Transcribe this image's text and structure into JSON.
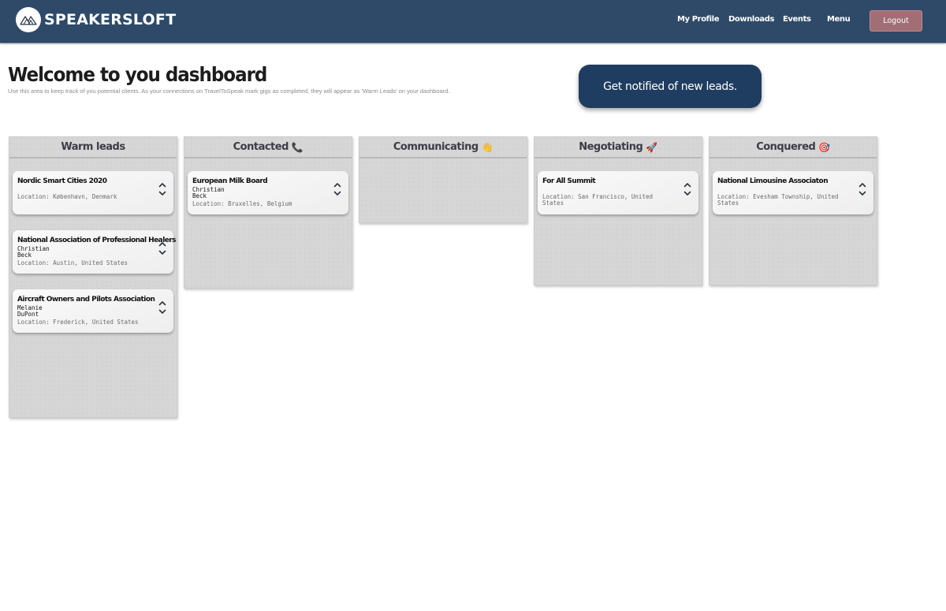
{
  "header": {
    "brand": "SPEAKERSLOFT",
    "logo_icon": "mountain-logo-icon",
    "nav": [
      {
        "label": "My Profile"
      },
      {
        "label": "Downloads"
      },
      {
        "label": "Events"
      },
      {
        "label": "Menu"
      }
    ],
    "logout_label": "Logout",
    "colors": {
      "bar": "#2e4a68",
      "logout": "#a06e74"
    }
  },
  "welcome": {
    "title": "Welcome to you dashboard",
    "subtitle": "Use this area to keep track of you potential clients. As your connections on TravelToSpeak mark gigs as completed, they will appear as 'Warm Leads' on your dashboard.",
    "notify_button": "Get notified of new leads.",
    "notify_color": "#1f3d60"
  },
  "board": {
    "columns": [
      {
        "title": "Warm leads",
        "emoji": "",
        "cards": [
          {
            "title": "Nordic Smart Cities 2020",
            "first_name": "",
            "last_name": "",
            "location": "Location: København, Denmark"
          },
          {
            "title": "National Association of Professional Healers",
            "first_name": "Christian",
            "last_name": "Beck",
            "location": "Location: Austin, United States"
          },
          {
            "title": "Aircraft Owners and Pilots Association",
            "first_name": "Melanie",
            "last_name": "DuPont",
            "location": "Location: Frederick, United States"
          }
        ]
      },
      {
        "title": "Contacted",
        "emoji": "📞",
        "cards": [
          {
            "title": "European Milk Board",
            "first_name": "Christian",
            "last_name": "Beck",
            "location": "Location: Bruxelles, Belgium"
          }
        ]
      },
      {
        "title": "Communicating",
        "emoji": "👋",
        "cards": []
      },
      {
        "title": "Negotiating",
        "emoji": "🚀",
        "cards": [
          {
            "title": "For All Summit",
            "first_name": "",
            "last_name": "",
            "location": "Location: San Francisco, United States"
          }
        ]
      },
      {
        "title": "Conquered",
        "emoji": "🎯",
        "cards": [
          {
            "title": "National Limousine Associaton",
            "first_name": "",
            "last_name": "",
            "location": "Location: Evesham Township, United States"
          }
        ]
      }
    ]
  },
  "icons": {
    "move_up": "chevron-up-icon",
    "move_down": "chevron-down-icon"
  }
}
